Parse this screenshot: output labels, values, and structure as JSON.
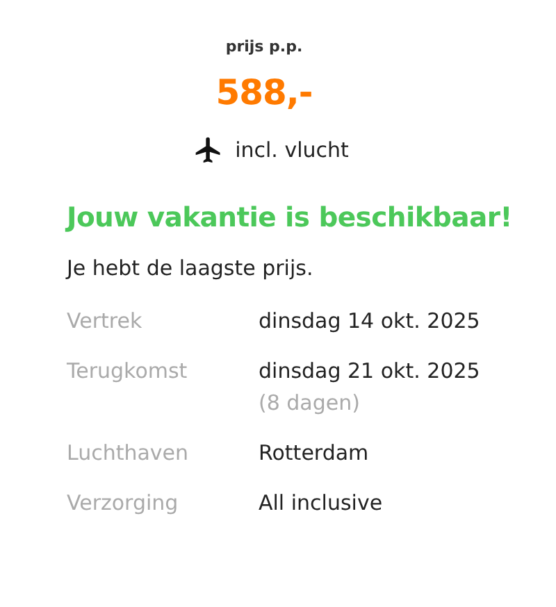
{
  "price": {
    "label": "prijs p.p.",
    "amount": "588,-",
    "includes": "incl. vlucht"
  },
  "availability": {
    "title": "Jouw vakantie is beschikbaar!",
    "message": "Je hebt de laagste prijs."
  },
  "details": [
    {
      "label": "Vertrek",
      "value": "dinsdag 14 okt. 2025"
    },
    {
      "label": "Terugkomst",
      "value": "dinsdag 21 okt. 2025",
      "note": "(8 dagen)"
    },
    {
      "label": "Luchthaven",
      "value": "Rotterdam"
    },
    {
      "label": "Verzorging",
      "value": "All inclusive"
    }
  ]
}
